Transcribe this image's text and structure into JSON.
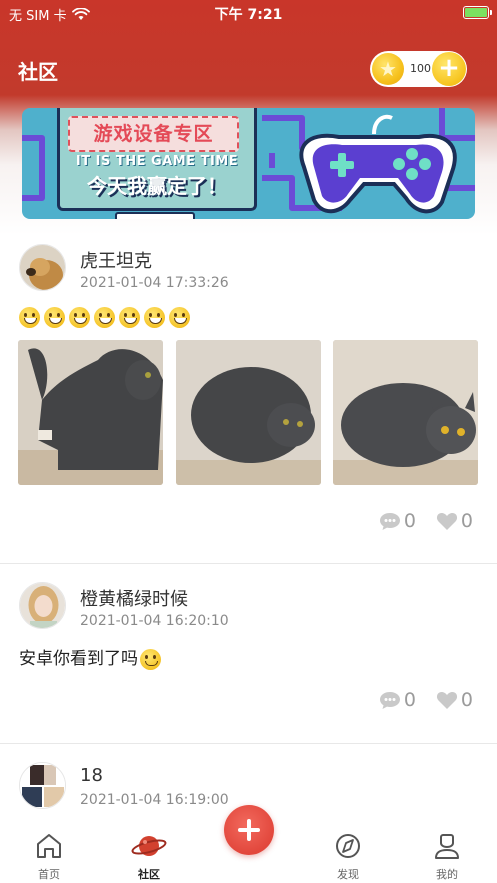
{
  "status_bar": {
    "carrier": "无 SIM 卡",
    "time": "下午 7:21"
  },
  "header": {
    "title": "社区",
    "coin_count": "100",
    "add_icon": "plus-icon",
    "coin_icon": "star-coin-icon"
  },
  "banner": {
    "title": "游戏设备专区",
    "subtitle_en": "IT IS THE GAME TIME",
    "subtitle_cn": "今天我赢定了！"
  },
  "posts": [
    {
      "username": "虎王坦克",
      "timestamp": "2021-01-04 17:33:26",
      "emoji_count": 7,
      "photos": [
        "cat-photo-1",
        "cat-photo-2",
        "cat-photo-3"
      ],
      "comments": "0",
      "likes": "0"
    },
    {
      "username": "橙黄橘绿时候",
      "timestamp": "2021-01-04 16:20:10",
      "text": "安卓你看到了吗",
      "comments": "0",
      "likes": "0"
    },
    {
      "username": "18",
      "timestamp": "2021-01-04 16:19:00"
    }
  ],
  "tabs": [
    {
      "label": "首页",
      "icon": "home-icon"
    },
    {
      "label": "社区",
      "icon": "planet-icon",
      "active": true
    },
    {
      "label": "发现",
      "icon": "compass-icon"
    },
    {
      "label": "我的",
      "icon": "profile-icon"
    }
  ],
  "colors": {
    "brand_red": "#c9362a",
    "fab_red": "#e2473c",
    "coin_yellow": "#f6c11d"
  }
}
